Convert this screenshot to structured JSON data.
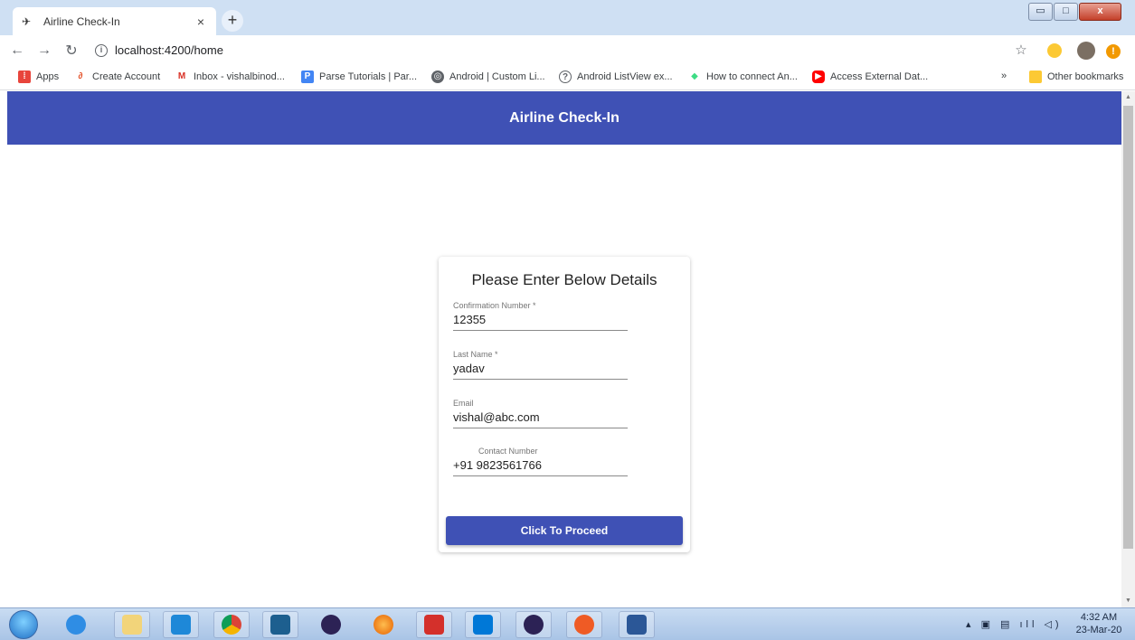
{
  "browser": {
    "tab_title": "Airline Check-In",
    "tab_close": "×",
    "new_tab": "+",
    "url": "localhost:4200/home",
    "window_controls": {
      "minimize": "▭",
      "maximize": "□",
      "close": "x"
    }
  },
  "bookmarks": {
    "items": [
      {
        "label": "Apps",
        "icon": "apps-grid-icon",
        "color": "#e8453c"
      },
      {
        "label": "Create Account",
        "icon": "create-account-icon",
        "color": "#e34f26"
      },
      {
        "label": "Inbox - vishalbinod...",
        "icon": "gmail-icon",
        "color": "#d93025"
      },
      {
        "label": "Parse Tutorials | Par...",
        "icon": "parse-icon",
        "color": "#4285f4"
      },
      {
        "label": "Android | Custom Li...",
        "icon": "globe-icon",
        "color": "#5f6368"
      },
      {
        "label": "Android ListView ex...",
        "icon": "question-icon",
        "color": "#5f6368"
      },
      {
        "label": "How to connect An...",
        "icon": "android-icon",
        "color": "#3ddc84"
      },
      {
        "label": "Access External Dat...",
        "icon": "youtube-icon",
        "color": "#ff0000"
      }
    ],
    "overflow": "»",
    "other": "Other bookmarks"
  },
  "app": {
    "header_title": "Airline Check-In",
    "form": {
      "title": "Please Enter Below Details",
      "fields": [
        {
          "label": "Confirmation Number *",
          "value": "12355"
        },
        {
          "label": "Last Name *",
          "value": "yadav"
        },
        {
          "label": "Email",
          "value": "vishal@abc.com"
        },
        {
          "label": "Contact Number",
          "value": "+91 9823561766"
        }
      ],
      "submit_label": "Click To Proceed"
    }
  },
  "taskbar": {
    "clock_time": "4:32 AM",
    "clock_date": "23-Mar-20",
    "tray_icons": "▴ ▣ ▤ ıll ◁)"
  },
  "colors": {
    "primary": "#3f51b5",
    "tab_strip": "#cfe0f3"
  }
}
